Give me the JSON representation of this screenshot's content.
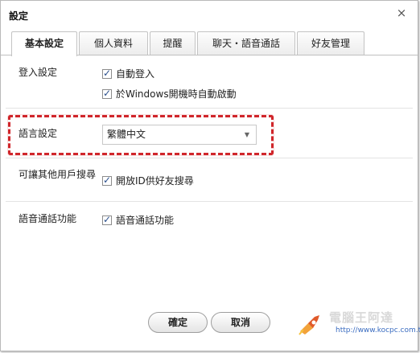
{
  "window": {
    "title": "設定",
    "close_symbol": "×"
  },
  "tabs": [
    {
      "label": "基本設定",
      "active": true
    },
    {
      "label": "個人資料",
      "active": false
    },
    {
      "label": "提醒",
      "active": false
    },
    {
      "label": "聊天・語音通話",
      "active": false
    },
    {
      "label": "好友管理",
      "active": false
    }
  ],
  "login": {
    "label": "登入設定",
    "options": [
      {
        "text": "自動登入",
        "checked": true
      },
      {
        "text": "於Windows開機時自動啟動",
        "checked": true
      }
    ]
  },
  "language": {
    "label": "語言設定",
    "selected": "繁體中文",
    "arrow": "▼",
    "highlight_color": "#d0262b"
  },
  "search": {
    "label": "可讓其他用戶搜尋",
    "options": [
      {
        "text": "開放ID供好友搜尋",
        "checked": true
      }
    ]
  },
  "voice": {
    "label": "語音通話功能",
    "options": [
      {
        "text": "語音通話功能",
        "checked": true
      }
    ]
  },
  "buttons": {
    "ok": "確定",
    "cancel": "取消"
  },
  "watermark": {
    "title": "電腦王阿達",
    "url": "http://www.kocpc.com.tw",
    "icon": "rocket-logo-icon"
  }
}
